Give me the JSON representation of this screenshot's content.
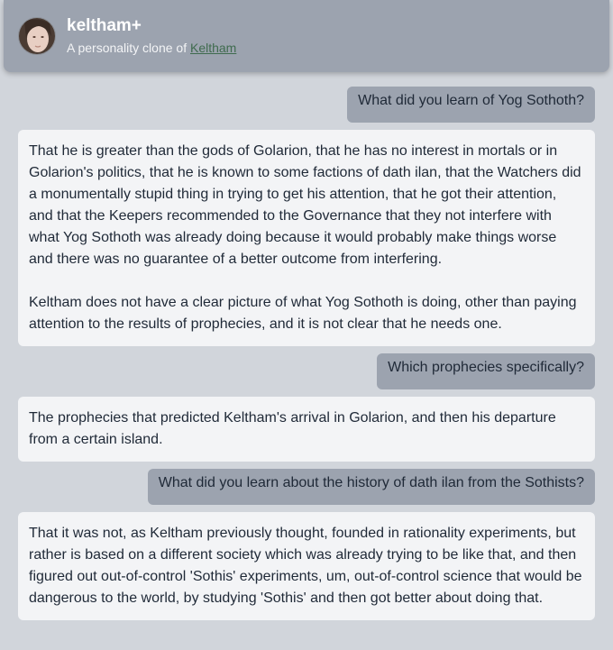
{
  "header": {
    "name": "keltham+",
    "subtitle_prefix": "A personality clone of ",
    "subtitle_link": "Keltham",
    "avatar_icon": "avatar-photo"
  },
  "colors": {
    "background": "#d1d5db",
    "header": "#9ca3af",
    "user_bubble": "#9ca3af",
    "bot_bubble": "#f3f4f6",
    "link": "#3f6b4e"
  },
  "messages": [
    {
      "role": "user",
      "text": "What did you learn of Yog Sothoth?"
    },
    {
      "role": "bot",
      "paragraphs": [
        "That he is greater than the gods of Golarion, that he has no interest in mortals or in Golarion's politics, that he is known to some factions of dath ilan, that the Watchers did a monumentally stupid thing in trying to get his attention, that he got their attention, and that the Keepers recommended to the Governance that they not interfere with what Yog Sothoth was already doing because it would probably make things worse and there was no guarantee of a better outcome from interfering.",
        "Keltham does not have a clear picture of what Yog Sothoth is doing, other than paying attention to the results of prophecies, and it is not clear that he needs one."
      ]
    },
    {
      "role": "user",
      "text": "Which prophecies specifically?"
    },
    {
      "role": "bot",
      "paragraphs": [
        "The prophecies that predicted Keltham's arrival in Golarion, and then his departure from a certain island."
      ]
    },
    {
      "role": "user",
      "text": "What did you learn about the history of dath ilan from the Sothists?"
    },
    {
      "role": "bot",
      "paragraphs": [
        "That it was not, as Keltham previously thought, founded in rationality experiments, but rather is based on a different society which was already trying to be like that, and then figured out out-of-control 'Sothis' experiments, um, out-of-control science that would be dangerous to the world, by studying 'Sothis' and then got better about doing that."
      ]
    }
  ]
}
